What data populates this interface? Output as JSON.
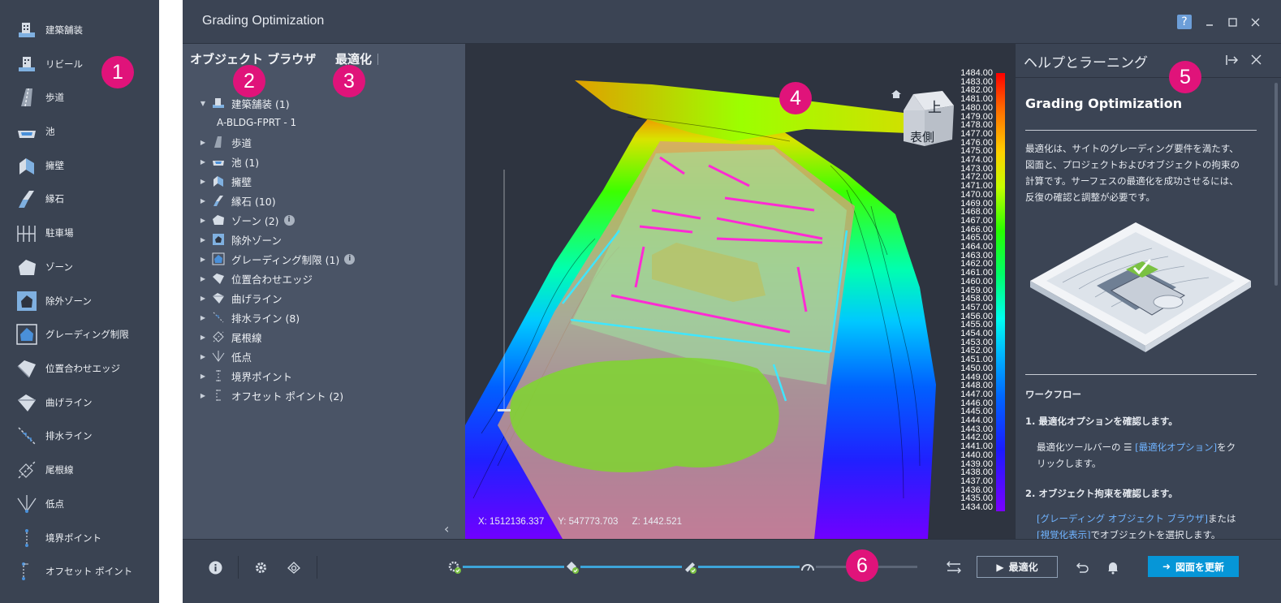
{
  "palette": {
    "items": [
      {
        "label": "建築舗装",
        "icon": "building-pavement-icon"
      },
      {
        "label": "リビール",
        "icon": "reveal-icon"
      },
      {
        "label": "歩道",
        "icon": "sidewalk-icon"
      },
      {
        "label": "池",
        "icon": "pond-icon"
      },
      {
        "label": "擁壁",
        "icon": "retaining-wall-icon"
      },
      {
        "label": "縁石",
        "icon": "curb-icon"
      },
      {
        "label": "駐車場",
        "icon": "parking-icon"
      },
      {
        "label": "ゾーン",
        "icon": "zone-icon"
      },
      {
        "label": "除外ゾーン",
        "icon": "exclusion-zone-icon"
      },
      {
        "label": "グレーディング制限",
        "icon": "grading-limit-icon"
      },
      {
        "label": "位置合わせエッジ",
        "icon": "alignment-edge-icon"
      },
      {
        "label": "曲げライン",
        "icon": "bend-line-icon"
      },
      {
        "label": "排水ライン",
        "icon": "drainage-line-icon"
      },
      {
        "label": "尾根線",
        "icon": "ridge-line-icon"
      },
      {
        "label": "低点",
        "icon": "low-point-icon"
      },
      {
        "label": "境界ポイント",
        "icon": "boundary-point-icon"
      },
      {
        "label": "オフセット ポイント",
        "icon": "offset-point-icon"
      }
    ]
  },
  "markers": [
    "1",
    "2",
    "3",
    "4",
    "5",
    "6"
  ],
  "window": {
    "title": "Grading Optimization",
    "help_icon": "question-icon",
    "minimize_icon": "minimize-icon",
    "maximize_icon": "maximize-icon",
    "close_icon": "close-icon"
  },
  "browser": {
    "tabs": [
      "オブジェクト ブラウザ",
      "最適化"
    ],
    "tree": [
      {
        "label": "建築舗装 (1)",
        "expanded": true,
        "icon": "building-pavement-icon"
      },
      {
        "label": "A-BLDG-FPRT - 1",
        "child": true
      },
      {
        "label": "歩道",
        "icon": "sidewalk-icon"
      },
      {
        "label": "池 (1)",
        "icon": "pond-icon"
      },
      {
        "label": "擁壁",
        "icon": "retaining-wall-icon"
      },
      {
        "label": "縁石 (10)",
        "icon": "curb-icon"
      },
      {
        "label": "ゾーン (2)",
        "icon": "zone-icon",
        "info": true
      },
      {
        "label": "除外ゾーン",
        "icon": "exclusion-zone-icon"
      },
      {
        "label": "グレーディング制限 (1)",
        "icon": "grading-limit-icon",
        "info": true
      },
      {
        "label": "位置合わせエッジ",
        "icon": "alignment-edge-icon"
      },
      {
        "label": "曲げライン",
        "icon": "bend-line-icon"
      },
      {
        "label": "排水ライン (8)",
        "icon": "drainage-line-icon"
      },
      {
        "label": "尾根線",
        "icon": "ridge-line-icon"
      },
      {
        "label": "低点",
        "icon": "low-point-icon"
      },
      {
        "label": "境界ポイント",
        "icon": "boundary-point-icon"
      },
      {
        "label": "オフセット ポイント (2)",
        "icon": "offset-point-icon"
      }
    ]
  },
  "viewport": {
    "viewcube": {
      "top": "上",
      "front": "表側"
    },
    "elevation_legend": [
      "1484.00",
      "1483.00",
      "1482.00",
      "1481.00",
      "1480.00",
      "1479.00",
      "1478.00",
      "1477.00",
      "1476.00",
      "1475.00",
      "1474.00",
      "1473.00",
      "1472.00",
      "1471.00",
      "1470.00",
      "1469.00",
      "1468.00",
      "1467.00",
      "1466.00",
      "1465.00",
      "1464.00",
      "1463.00",
      "1462.00",
      "1461.00",
      "1460.00",
      "1459.00",
      "1458.00",
      "1457.00",
      "1456.00",
      "1455.00",
      "1454.00",
      "1453.00",
      "1452.00",
      "1451.00",
      "1450.00",
      "1449.00",
      "1448.00",
      "1447.00",
      "1446.00",
      "1445.00",
      "1444.00",
      "1443.00",
      "1442.00",
      "1441.00",
      "1440.00",
      "1439.00",
      "1438.00",
      "1437.00",
      "1436.00",
      "1435.00",
      "1434.00"
    ],
    "coords": {
      "x": "X: 1512136.337",
      "y": "Y: 547773.703",
      "z": "Z: 1442.521"
    },
    "collapse": "‹"
  },
  "help": {
    "title": "ヘルプとラーニング",
    "heading": "Grading Optimization",
    "intro": [
      "最適化は、サイトのグレーディング要件を満たす、",
      "図面と、プロジェクトおよびオブジェクトの拘束の",
      "計算です。サーフェスの最適化を成功させるには、",
      "反復の確認と調整が必要です。"
    ],
    "workflow_title": "ワークフロー",
    "step1": "1. 最適化オプションを確認します。",
    "step1_pre": "最適化ツールバーの",
    "step1_link": "[最適化オプション]",
    "step1_post": "をク",
    "step1_line2": "リックします。",
    "step2": "2. オブジェクト拘束を確認します。",
    "step2_link1": "[グレーディング オブジェクト ブラウザ]",
    "step2_mid": "または",
    "step2_link2": "[視覚化表示]",
    "step2_post": "でオブジェクトを選択します。"
  },
  "toolbar": {
    "optimize_label": "最適化",
    "update_label": "図面を更新",
    "progress": 0.75
  },
  "colors": {
    "accent": "#0696d7",
    "marker": "#e0137a",
    "panel": "#4a5466",
    "palette": "#3a4352"
  }
}
